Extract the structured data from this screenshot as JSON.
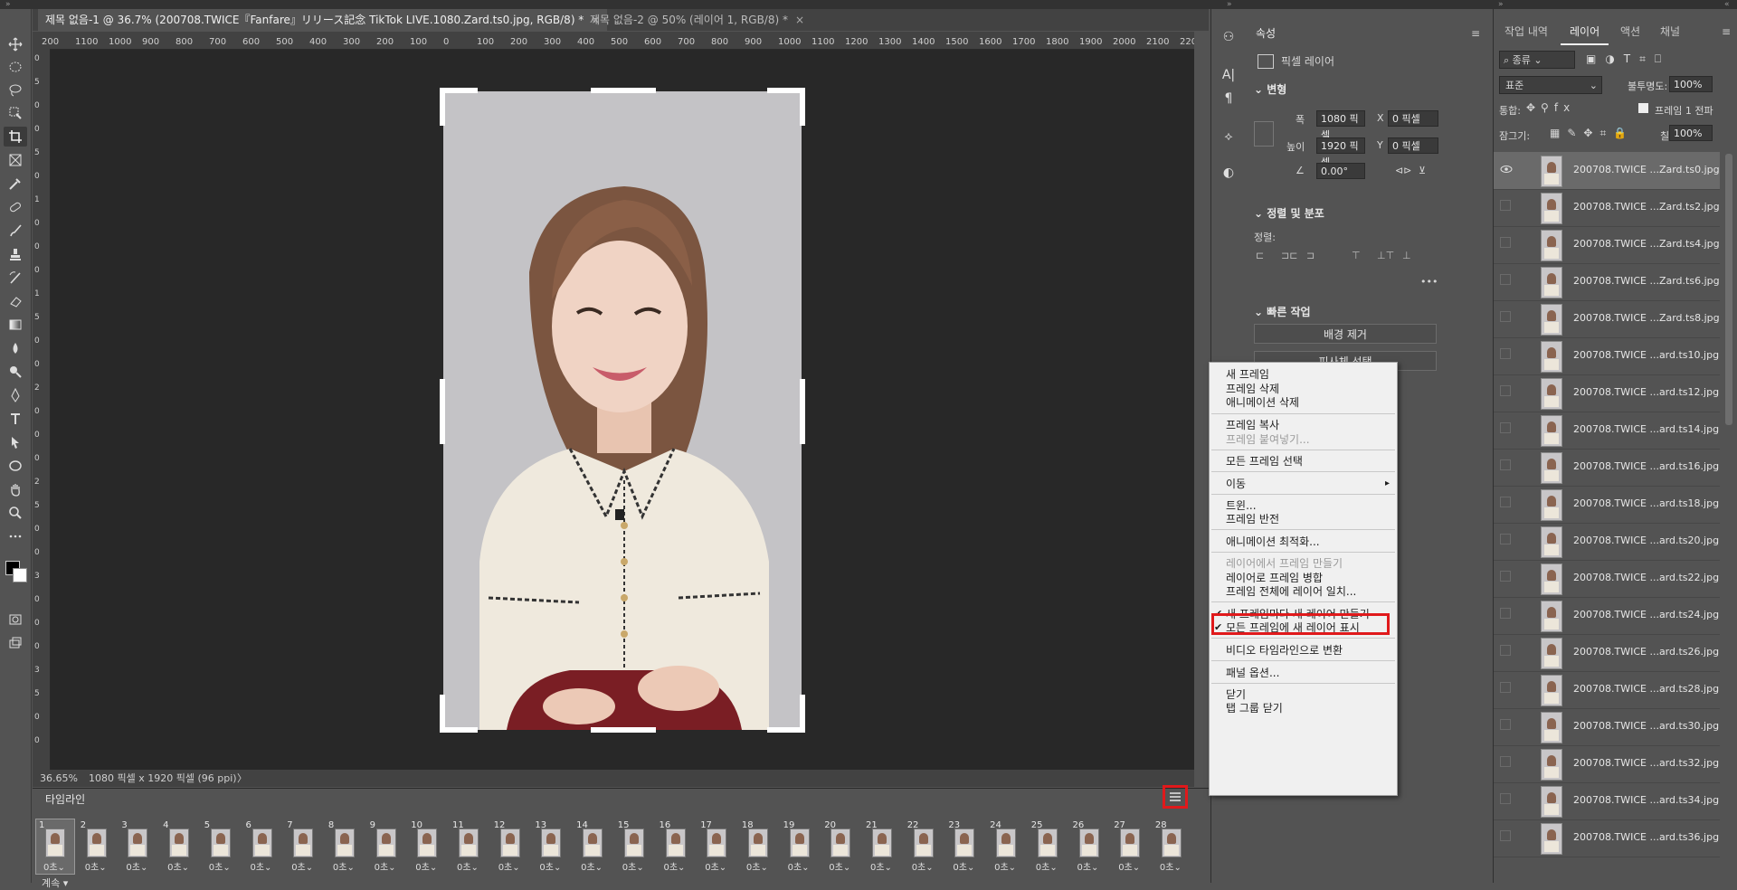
{
  "document_tabs": [
    {
      "label": "제목 없음-1 @ 36.7% (200708.TWICE『Fanfare』リリース記念 TikTok LIVE.1080.Zard.ts0.jpg, RGB/8) *",
      "close": "×"
    },
    {
      "label": "제목 없음-2 @ 50% (레이어 1, RGB/8) *",
      "close": "×"
    }
  ],
  "ruler_ticks": [
    "200",
    "1100",
    "1000",
    "900",
    "800",
    "700",
    "600",
    "500",
    "400",
    "300",
    "200",
    "100",
    "0",
    "100",
    "200",
    "300",
    "400",
    "500",
    "600",
    "700",
    "800",
    "900",
    "1000",
    "1100",
    "1200",
    "1300",
    "1400",
    "1500",
    "1600",
    "1700",
    "1800",
    "1900",
    "2000",
    "2100",
    "2200"
  ],
  "ruler_vertical": [
    "0",
    "5",
    "0",
    "0",
    "5",
    "0",
    "1",
    "0",
    "0",
    "0",
    "1",
    "5",
    "0",
    "0",
    "2",
    "0",
    "0",
    "0",
    "2",
    "5",
    "0",
    "0",
    "3",
    "0",
    "0",
    "0",
    "3",
    "5",
    "0",
    "0"
  ],
  "status": {
    "zoom": "36.65%",
    "info": "1080 픽셀 x 1920 픽셀 (96 ppi)",
    "arrow": "〉"
  },
  "timeline": {
    "tab_label": "타임라인",
    "frames": [
      "1",
      "2",
      "3",
      "4",
      "5",
      "6",
      "7",
      "8",
      "9",
      "10",
      "11",
      "12",
      "13",
      "14",
      "15",
      "16",
      "17",
      "18",
      "19",
      "20",
      "21",
      "22",
      "23",
      "24",
      "25",
      "26",
      "27",
      "28"
    ],
    "duration": "0초⌄",
    "loop_label": "계속"
  },
  "properties": {
    "tab": "속성",
    "layer_kind": "픽셀 레이어",
    "transform_title": "변형",
    "width_label": "폭",
    "width_value": "1080 픽셀",
    "x_label": "X",
    "x_value": "0 픽셀",
    "height_label": "높이",
    "height_value": "1920 픽셀",
    "y_label": "Y",
    "y_value": "0 픽셀",
    "angle_value": "0.00°",
    "align_title": "정렬 및 분포",
    "align_label": "정렬:",
    "more": "•••",
    "quick_title": "빠른 작업",
    "quick_btn1": "배경 제거",
    "quick_btn2": "피사체 선택"
  },
  "layers": {
    "tabs": [
      "작업 내역",
      "레이어",
      "액션",
      "채널"
    ],
    "filter_label": "종류",
    "blend_mode": "표준",
    "opacity_label": "불투명도:",
    "opacity_value": "100%",
    "unify_label": "통합:",
    "propagate_label": "프레임 1 전파",
    "lock_label": "잠그기:",
    "fill_label": "칠:",
    "fill_value": "100%",
    "items": [
      "200708.TWICE ...Zard.ts0.jpg",
      "200708.TWICE ...Zard.ts2.jpg",
      "200708.TWICE ...Zard.ts4.jpg",
      "200708.TWICE ...Zard.ts6.jpg",
      "200708.TWICE ...Zard.ts8.jpg",
      "200708.TWICE ...ard.ts10.jpg",
      "200708.TWICE ...ard.ts12.jpg",
      "200708.TWICE ...ard.ts14.jpg",
      "200708.TWICE ...ard.ts16.jpg",
      "200708.TWICE ...ard.ts18.jpg",
      "200708.TWICE ...ard.ts20.jpg",
      "200708.TWICE ...ard.ts22.jpg",
      "200708.TWICE ...ard.ts24.jpg",
      "200708.TWICE ...ard.ts26.jpg",
      "200708.TWICE ...ard.ts28.jpg",
      "200708.TWICE ...ard.ts30.jpg",
      "200708.TWICE ...ard.ts32.jpg",
      "200708.TWICE ...ard.ts34.jpg",
      "200708.TWICE ...ard.ts36.jpg"
    ]
  },
  "context_menu": {
    "new_frame": "새 프레임",
    "delete_frame": "프레임 삭제",
    "delete_animation": "애니메이션 삭제",
    "copy_frame": "프레임 복사",
    "paste_frame": "프레임 붙여넣기...",
    "select_all": "모든 프레임 선택",
    "move": "이동",
    "tween": "트윈...",
    "reverse": "프레임 반전",
    "optimize": "애니메이션 최적화...",
    "make_from_layers": "레이어에서 프레임 만들기",
    "flatten_to_layers": "레이어로 프레임 병합",
    "match_layer": "프레임 전체에 레이어 일치...",
    "new_layer_each": "새 프레임마다 새 레이어 만들기",
    "show_new_layers": "모든 프레임에 새 레이어 표시",
    "convert_video": "비디오 타임라인으로 변환",
    "panel_options": "패널 옵션...",
    "close": "닫기",
    "close_group": "탭 그룹 닫기",
    "submenu_arrow": "▸",
    "check": "✔"
  },
  "colors": {
    "highlight": "#e0191b",
    "panel": "#535353",
    "canvas": "#282828"
  }
}
